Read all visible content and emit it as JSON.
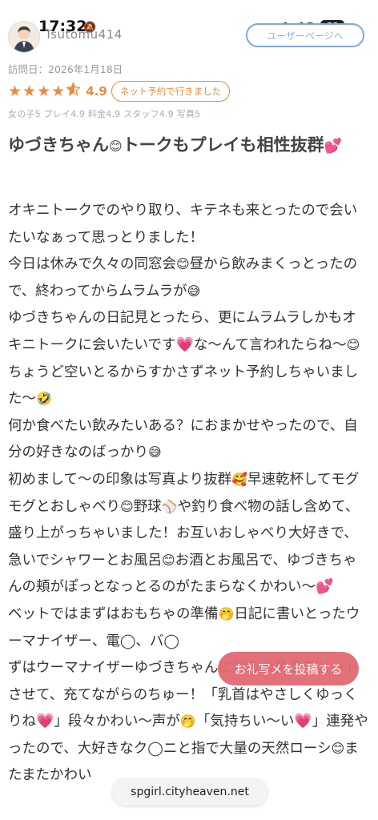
{
  "status_bar": {
    "time": "17:32",
    "network": "4G",
    "battery": "69"
  },
  "header": {
    "username": "Tsutomu414",
    "mypage_button": "ユーザーページへ"
  },
  "review": {
    "visit_date": "訪問日：2026年1月18日",
    "rating": "4.9",
    "stars": 4.9,
    "badge": "ネット予約で行きました",
    "subscores": "女の子5 プレイ4.9 料金4.9 スタッフ4.9 写真5",
    "title_part1": "ゆづきちゃん",
    "title_part2": "トークもプレイも相性抜群",
    "lines": [
      "オキニトークでのやり取り、キテネも来とったので会いたいなぁって思っとりました！",
      "今日は休みで久々の同窓会",
      "昼から飲みまくっとったので、終わってからムラムラが",
      "ゆづきちゃんの日記見とったら、更にムラムラしかもオキニトークに会いたいです",
      "な〜んて言われたらね〜",
      "ちょうど空いとるからすかさずネット予約しちゃいました〜",
      "何か食べたい飲みたいある？におまかせやったので、自分の好きなのばっかり",
      "初めまして〜の印象は写真より抜群",
      "早速乾杯してモグモグとおしゃべり",
      "野球",
      "や釣り食べ物の話し含めて、盛り上がっちゃいました！お互いおしゃべり大好きで、急いでシャワーとお風呂",
      "お酒とお風呂で、ゆづきちゃんの頬がぽっとなっとるのがたまらなくかわい〜",
      "ベットではまずはおもちゃの準備",
      "日記に書いとったウーマナイザー、電◯、バ◯",
      "ずはウーマナイザーゆづきちゃんに好みの具合をセットさせて、充てながらのちゅー！「乳首はやさしくゆっくりね",
      "」段々かわい〜声が",
      "「気持ちい〜い",
      "」連発やったので、大好きなク◯ニと指で大量の天然ローシ",
      "またまたかわい"
    ]
  },
  "floating": {
    "post_button": "お礼写メを投稿する",
    "url": "spgirl.cityheaven.net"
  },
  "colors": {
    "accent": "#ee8a3f",
    "post_button": "#e26a72",
    "link_blue": "#7da7e6"
  }
}
